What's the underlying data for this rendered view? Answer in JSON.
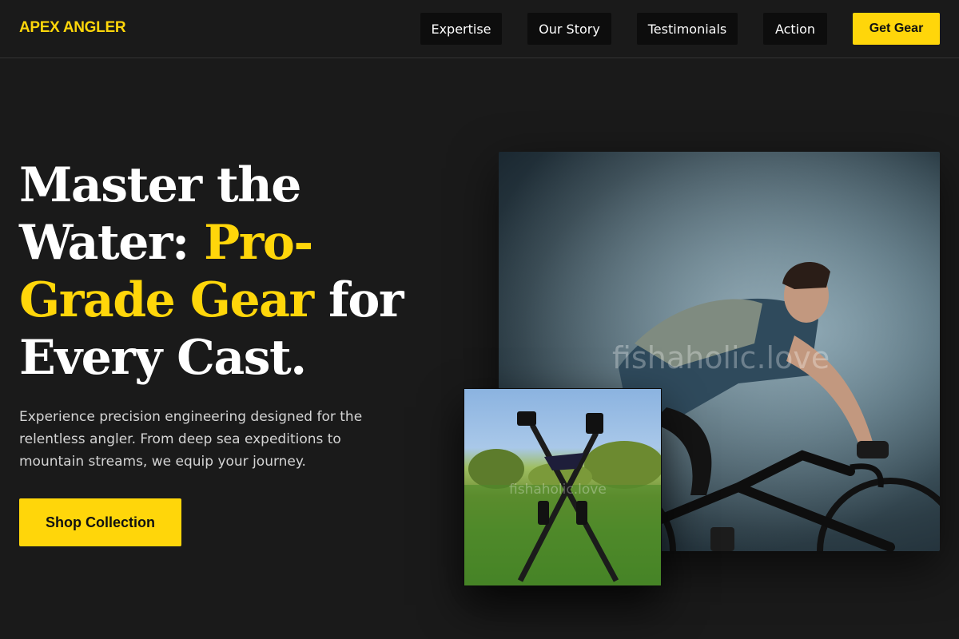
{
  "header": {
    "logo": "APEX ANGLER",
    "nav": [
      "Expertise",
      "Our Story",
      "Testimonials",
      "Action"
    ],
    "cta_label": "Get Gear"
  },
  "hero": {
    "title_line1": "Master the",
    "title_line2_pre": "Water: ",
    "title_line2_accent": "Pro-",
    "title_line3_accent": "Grade Gear",
    "title_line3_post": " for",
    "title_line4": "Every Cast.",
    "subtitle": "Experience precision engineering designed for the relentless angler. From deep sea expeditions to mountain streams, we equip your journey.",
    "button_label": "Shop Collection"
  },
  "images": {
    "main_watermark": "fishaholic.love",
    "small_watermark": "fishaholic.love"
  },
  "colors": {
    "accent": "#ffd60a",
    "background": "#1a1a1a",
    "nav_button": "#0d0d0d"
  }
}
